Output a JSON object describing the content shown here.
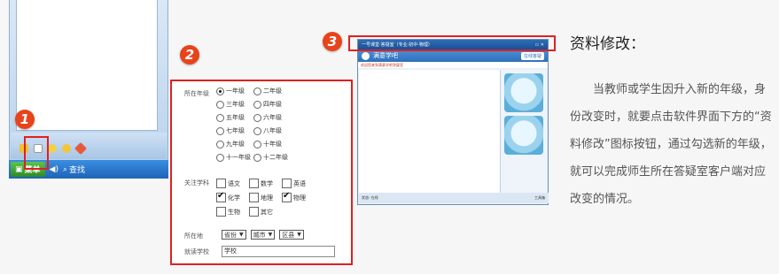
{
  "left_window": {
    "start_label": "菜单",
    "search_label": "查找"
  },
  "badges": {
    "one": "1",
    "two": "2",
    "three": "3"
  },
  "form": {
    "grade_label": "所在年级",
    "grades": [
      "一年级",
      "二年级",
      "三年级",
      "四年级",
      "五年级",
      "六年级",
      "七年级",
      "八年级",
      "九年级",
      "十年级",
      "十一年级",
      "十二年级"
    ],
    "selected_grade": "一年级",
    "subject_label": "关注学科",
    "subjects": [
      "语文",
      "数学",
      "英语",
      "化学",
      "地理",
      "物理",
      "生物",
      "其它"
    ],
    "checked_subjects": [
      "化学",
      "物理"
    ],
    "location_label": "所在地",
    "location_selects": [
      "省份",
      "城市",
      "区县"
    ],
    "school_label": "就读学校",
    "school_value": "学校"
  },
  "app": {
    "title": "一号课堂·答疑室（专业:初中·物理）",
    "head_title": "满意学吧",
    "head_button": "在线答疑",
    "notice": "欢迎您来到满意学吧答疑室",
    "status_left": "状态: 在线",
    "status_right": "工具箱"
  },
  "description": {
    "title": "资料修改：",
    "body": "当教师或学生因升入新的年级，身份改变时，就要点击软件界面下方的“资料修改”图标按钮，通过勾选新的年级，就可以完成师生所在答疑室客户端对应改变的情况。"
  },
  "colors": {
    "highlight": "#e02020",
    "badge": "#e8431b",
    "text": "#555555"
  }
}
